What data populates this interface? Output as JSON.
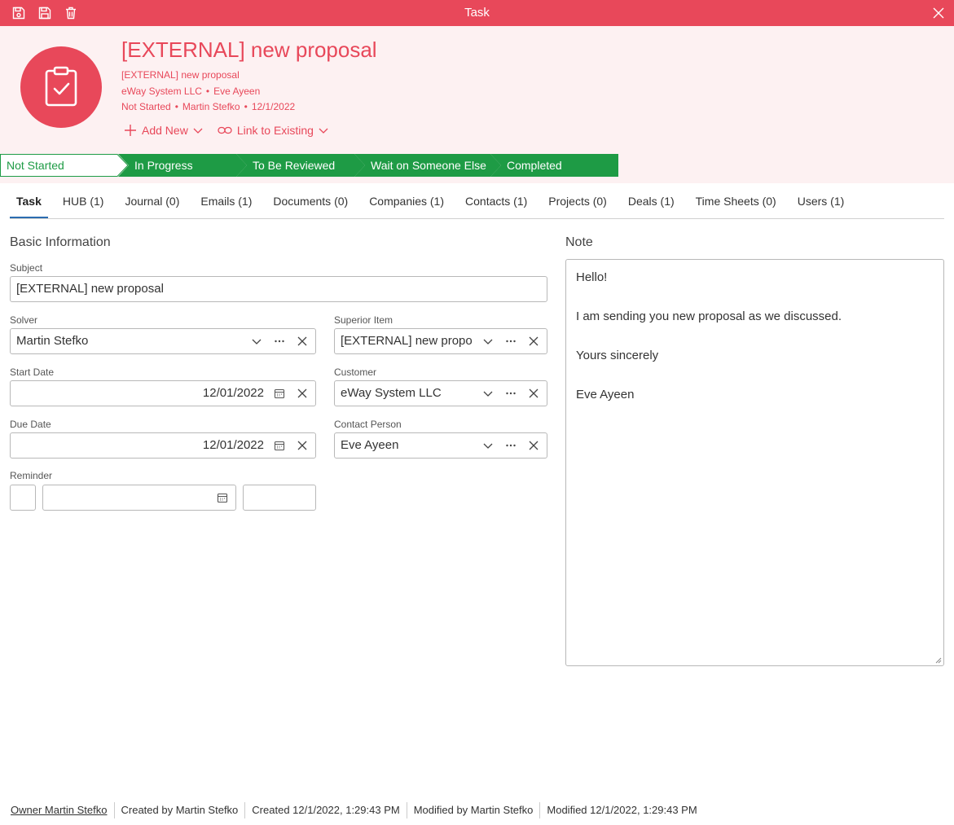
{
  "window": {
    "title": "Task"
  },
  "header": {
    "title": "[EXTERNAL] new proposal",
    "subtitle": "[EXTERNAL] new proposal",
    "company": "eWay System LLC",
    "contact": "Eve Ayeen",
    "status": "Not Started",
    "solver": "Martin Stefko",
    "date": "12/1/2022",
    "add_new_label": "Add New",
    "link_existing_label": "Link to Existing",
    "accent_color": "#e8485a"
  },
  "stages": [
    {
      "label": "Not Started",
      "current": true
    },
    {
      "label": "In Progress",
      "current": false
    },
    {
      "label": "To Be Reviewed",
      "current": false
    },
    {
      "label": "Wait on Someone Else",
      "current": false
    },
    {
      "label": "Completed",
      "current": false
    }
  ],
  "tabs": [
    {
      "label": "Task",
      "active": true
    },
    {
      "label": "HUB (1)"
    },
    {
      "label": "Journal (0)"
    },
    {
      "label": "Emails (1)"
    },
    {
      "label": "Documents (0)"
    },
    {
      "label": "Companies (1)"
    },
    {
      "label": "Contacts (1)"
    },
    {
      "label": "Projects (0)"
    },
    {
      "label": "Deals (1)"
    },
    {
      "label": "Time Sheets (0)"
    },
    {
      "label": "Users (1)"
    }
  ],
  "basic": {
    "section_title": "Basic Information",
    "subject_label": "Subject",
    "subject_value": "[EXTERNAL] new proposal",
    "solver_label": "Solver",
    "solver_value": "Martin Stefko",
    "superior_label": "Superior Item",
    "superior_value": "[EXTERNAL] new propo",
    "start_label": "Start Date",
    "start_value": "12/01/2022",
    "customer_label": "Customer",
    "customer_value": "eWay System LLC",
    "due_label": "Due Date",
    "due_value": "12/01/2022",
    "contact_label": "Contact Person",
    "contact_value": "Eve Ayeen",
    "reminder_label": "Reminder"
  },
  "note": {
    "section_title": "Note",
    "text": "Hello!\n\nI am sending you new proposal as we discussed.\n\nYours sincerely\n\nEve Ayeen"
  },
  "footer": {
    "owner": "Owner Martin Stefko",
    "created_by": "Created by Martin Stefko",
    "created": "Created 12/1/2022, 1:29:43 PM",
    "modified_by": "Modified by Martin Stefko",
    "modified": "Modified 12/1/2022, 1:29:43 PM"
  },
  "colors": {
    "stage_green": "#1e9b45",
    "accent": "#e8485a",
    "tab_underline": "#2b6cb0"
  }
}
